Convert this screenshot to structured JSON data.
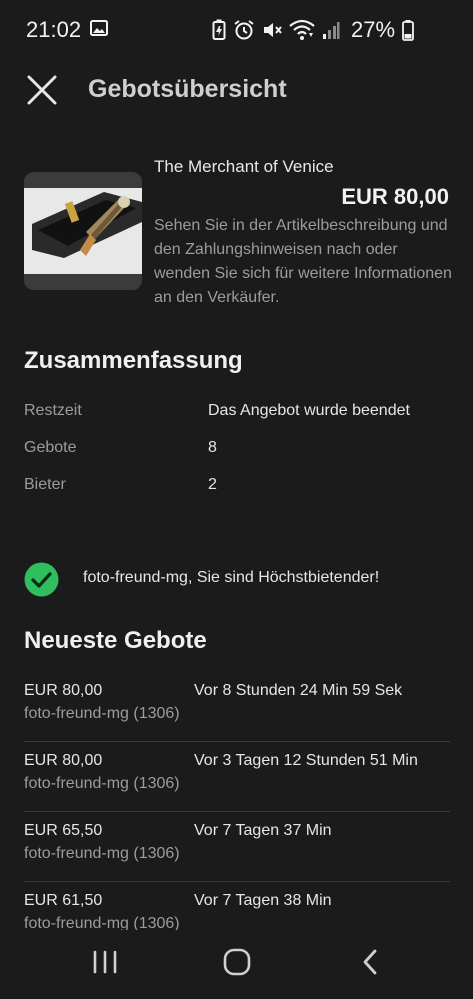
{
  "status_bar": {
    "time": "21:02",
    "battery_percent": "27%",
    "icons": [
      "gallery-icon",
      "battery-saver-icon",
      "alarm-icon",
      "mute-icon",
      "wifi-icon",
      "signal-icon",
      "battery-icon"
    ]
  },
  "header": {
    "title": "Gebotsübersicht",
    "close_icon": "close-icon"
  },
  "item": {
    "title": "The Merchant of Venice",
    "price": "EUR 80,00",
    "note": "Sehen Sie in der Artikelbeschreibung und den Zahlungshinweisen nach oder wenden Sie sich für weitere Informationen an den Verkäufer."
  },
  "summary": {
    "heading": "Zusammenfassung",
    "rows": [
      {
        "label": "Restzeit",
        "value": "Das Angebot wurde beendet"
      },
      {
        "label": "Gebote",
        "value": "8"
      },
      {
        "label": "Bieter",
        "value": "2"
      }
    ]
  },
  "highest_bidder": {
    "icon": "check-circle-icon",
    "message": "foto-freund-mg, Sie sind Höchstbietender!",
    "accent_color": "#2fbf5f"
  },
  "bids": {
    "heading": "Neueste Gebote",
    "rows": [
      {
        "amount": "EUR 80,00",
        "time": "Vor 8 Stunden 24 Min 59 Sek",
        "bidder": "foto-freund-mg (1306)"
      },
      {
        "amount": "EUR 80,00",
        "time": "Vor 3 Tagen 12 Stunden 51 Min",
        "bidder": "foto-freund-mg (1306)"
      },
      {
        "amount": "EUR 65,50",
        "time": "Vor 7 Tagen 37 Min",
        "bidder": "foto-freund-mg (1306)"
      },
      {
        "amount": "EUR 61,50",
        "time": "Vor 7 Tagen 38 Min",
        "bidder": "foto-freund-mg (1306)"
      }
    ]
  },
  "nav_bar": {
    "buttons": [
      "recents-icon",
      "home-icon",
      "back-icon"
    ]
  }
}
